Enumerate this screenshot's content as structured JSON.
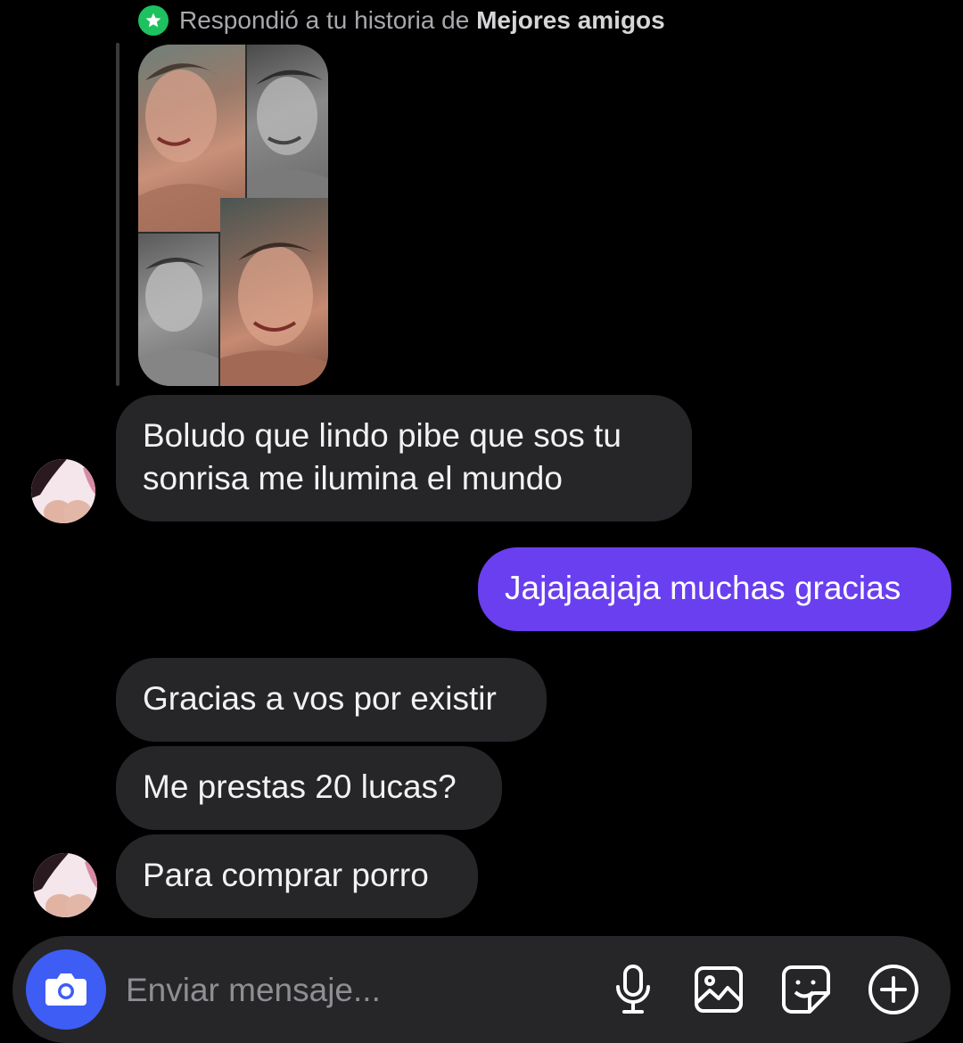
{
  "story_reply": {
    "prefix": "Respondió a tu historia de",
    "audience": "Mejores amigos"
  },
  "messages": [
    {
      "sender": "other",
      "text": "Boludo que lindo pibe que sos tu\nsonrisa me ilumina el mundo"
    },
    {
      "sender": "me",
      "text": "Jajajaajaja muchas gracias"
    },
    {
      "sender": "other",
      "text": "Gracias a vos por existir"
    },
    {
      "sender": "other",
      "text": "Me prestas 20 lucas?"
    },
    {
      "sender": "other",
      "text": "Para comprar porro"
    }
  ],
  "composer": {
    "placeholder": "Enviar mensaje...",
    "icons": [
      "camera-icon",
      "microphone-icon",
      "gallery-icon",
      "sticker-icon",
      "add-icon"
    ]
  },
  "colors": {
    "background": "#000000",
    "incoming_bubble": "#262629",
    "outgoing_bubble": "#6a3ff0",
    "camera_button": "#3d5df5",
    "best_friends_badge": "#1ec15f"
  }
}
